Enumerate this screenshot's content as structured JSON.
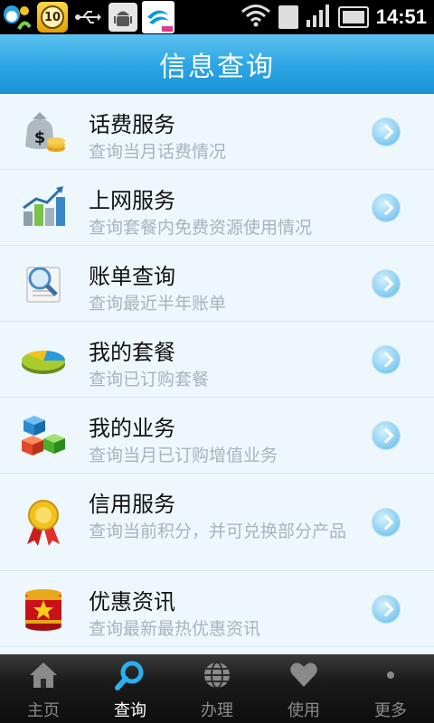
{
  "status_bar": {
    "notification_badge": "10",
    "time": "14:51"
  },
  "header": {
    "title": "信息查询"
  },
  "menu": [
    {
      "title": "话费服务",
      "subtitle": "查询当月话费情况",
      "icon": "money-bag-icon"
    },
    {
      "title": "上网服务",
      "subtitle": "查询套餐内免费资源使用情况",
      "icon": "bar-chart-icon"
    },
    {
      "title": "账单查询",
      "subtitle": "查询最近半年账单",
      "icon": "magnifier-document-icon"
    },
    {
      "title": "我的套餐",
      "subtitle": "查询已订购套餐",
      "icon": "pie-chart-icon"
    },
    {
      "title": "我的业务",
      "subtitle": "查询当月已订购增值业务",
      "icon": "cubes-icon"
    },
    {
      "title": "信用服务",
      "subtitle": "查询当前积分，并可兑换部分产品",
      "icon": "award-ribbon-icon"
    },
    {
      "title": "优惠资讯",
      "subtitle": "查询最新最热优惠资讯",
      "icon": "star-drum-icon"
    }
  ],
  "tabs": [
    {
      "label": "主页",
      "icon": "home-icon",
      "active": false
    },
    {
      "label": "查询",
      "icon": "search-icon",
      "active": true
    },
    {
      "label": "办理",
      "icon": "globe-icon",
      "active": false
    },
    {
      "label": "使用",
      "icon": "heart-icon",
      "active": false
    },
    {
      "label": "更多",
      "icon": "more-dots-icon",
      "active": false
    }
  ],
  "colors": {
    "header_blue": "#2ea6e4",
    "list_background": "#eef7fc",
    "subtitle_gray": "#a8b4bb"
  }
}
